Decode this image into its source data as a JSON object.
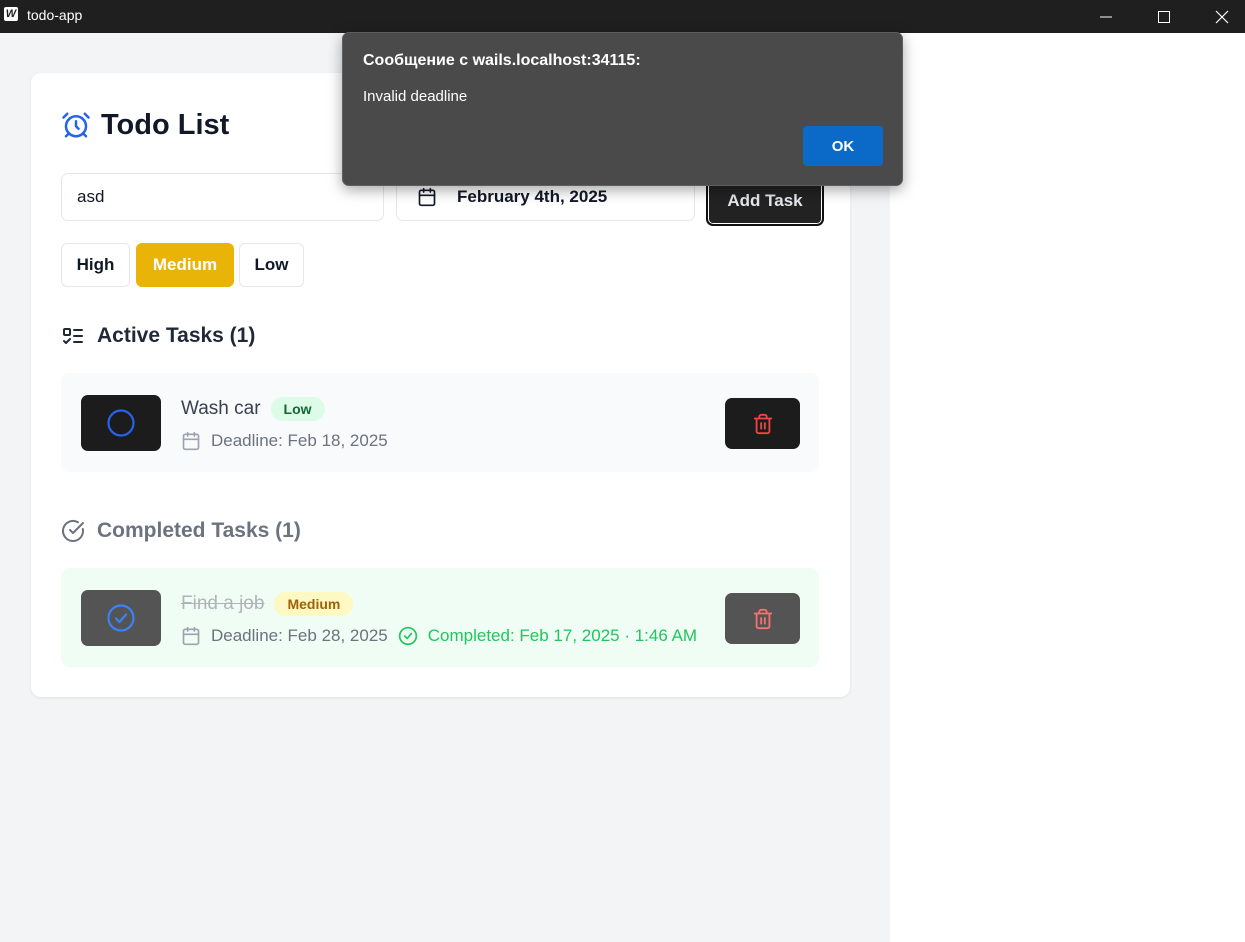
{
  "window": {
    "title": "todo-app",
    "icon_letter": "W",
    "controls": [
      "minimize-icon",
      "maximize-icon",
      "close-icon"
    ]
  },
  "header": {
    "title": "Todo List",
    "icon": "alarm-clock-icon"
  },
  "form": {
    "task_input_value": "asd",
    "date_value": "February 4th, 2025",
    "add_button_label": "Add Task",
    "priorities": [
      "High",
      "Medium",
      "Low"
    ],
    "selected_priority": "Medium"
  },
  "active_section": {
    "title": "Active Tasks (1)",
    "tasks": [
      {
        "name": "Wash car",
        "priority": "Low",
        "deadline": "Deadline: Feb 18, 2025"
      }
    ]
  },
  "completed_section": {
    "title": "Completed Tasks (1)",
    "tasks": [
      {
        "name": "Find a job",
        "priority": "Medium",
        "deadline": "Deadline: Feb 28, 2025",
        "completed": "Completed: Feb 17, 2025 · 1:46 AM"
      }
    ]
  },
  "dialog": {
    "title": "Сообщение с wails.localhost:34115:",
    "message": "Invalid deadline",
    "ok_label": "OK"
  },
  "colors": {
    "accent_blue": "#2563eb",
    "priority_medium": "#eab308",
    "success_green": "#22c55e",
    "danger_red": "#ef4444",
    "dialog_ok": "#0b6ac7"
  }
}
